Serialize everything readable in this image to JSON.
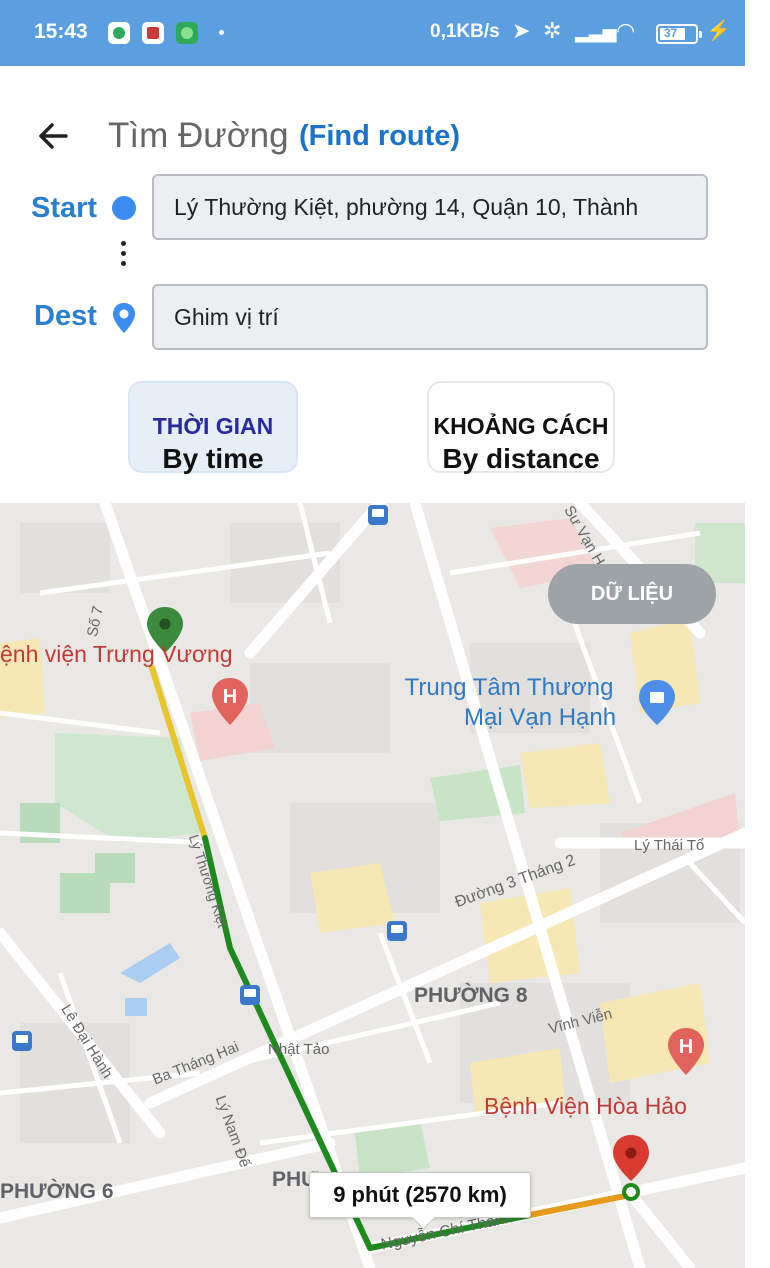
{
  "status_bar": {
    "time": "15:43",
    "speed": "0,1KB/s",
    "battery": "37",
    "icons": [
      "shield-app-icon",
      "news-app-icon",
      "chat-app-icon",
      "location-icon",
      "mute-icon",
      "signal-icon",
      "wifi-icon",
      "battery-icon",
      "charging-icon"
    ]
  },
  "header": {
    "title": "Tìm Đường",
    "title_en": "(Find route)"
  },
  "form": {
    "start_label": "Start",
    "start_value": "Lý Thường Kiệt, phường 14, Quận 10, Thành",
    "dest_label": "Dest",
    "dest_value": "Ghim vị trí"
  },
  "modes": {
    "time_vi": "THỜI GIAN",
    "time_en": "By time",
    "distance_vi": "KHOẢNG CÁCH",
    "distance_en": "By distance",
    "selected": "time"
  },
  "map": {
    "data_button": "DỮ LIỆU",
    "labels": {
      "hospital_trung_vuong": "ệnh viện Trưng Vương",
      "mall_line1": "Trung Tâm Thương",
      "mall_line2": "Mại Vạn Hạnh",
      "ward8": "PHƯỜNG 8",
      "ward6": "PHƯỜNG 6",
      "ward_partial": "PHƯ",
      "hospital_hoa_hao": "Bệnh Viện Hòa Hảo",
      "road_3thang2": "Đường 3 Tháng 2",
      "road_ly_thai_to": "Lý Thái Tổ",
      "road_ly_thuong_kiet": "Lý Thường Kiệt",
      "road_ba_thang_hai": "Ba Tháng Hai",
      "road_nhat_tao": "Nhật Tảo",
      "road_le_dai_hanh": "Lê Đại Hành",
      "road_ly_nam_de": "Lý Nam Đế",
      "road_vinh_vien": "Vĩnh Viễn",
      "road_nguyen_chi_thanh": "Nguyễn Chí Thanh",
      "road_su_van_hanh": "Sư Vạn Hạnh",
      "road_so7": "Số 7"
    },
    "route_info": "9 phút (2570 km)",
    "colors": {
      "route_green": "#1e8a1e",
      "route_yellow": "#e8c52a",
      "route_orange": "#e59a1c",
      "start_pin": "#3c8a3c",
      "dest_pin": "#d93b2f"
    }
  }
}
